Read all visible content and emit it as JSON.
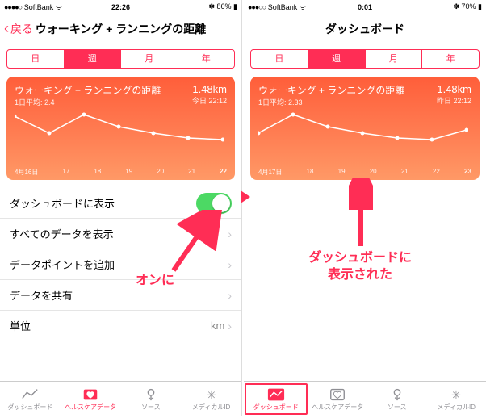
{
  "left": {
    "status": {
      "carrier": "SoftBank",
      "time": "22:26",
      "bt": "86%"
    },
    "back": "戻る",
    "title": "ウォーキング + ランニングの距離",
    "seg": [
      "日",
      "週",
      "月",
      "年"
    ],
    "card": {
      "title": "ウォーキング + ランニングの距離",
      "sub": "1日平均: 2.4",
      "val": "1.48km",
      "time": "今日 22:12",
      "xaxis": [
        "4月16日",
        "17",
        "18",
        "19",
        "20",
        "21",
        "22"
      ]
    },
    "rows": {
      "dash": "ダッシュボードに表示",
      "all": "すべてのデータを表示",
      "pt": "データポイントを追加",
      "share": "データを共有",
      "unit": "単位",
      "unit_val": "km"
    },
    "tabs": [
      "ダッシュボード",
      "ヘルスケアデータ",
      "ソース",
      "メディカルID"
    ],
    "annot": "オンに"
  },
  "right": {
    "status": {
      "carrier": "SoftBank",
      "time": "0:01",
      "bt": "70%"
    },
    "title": "ダッシュボード",
    "seg": [
      "日",
      "週",
      "月",
      "年"
    ],
    "card": {
      "title": "ウォーキング + ランニングの距離",
      "sub": "1日平均: 2.33",
      "val": "1.48km",
      "time": "昨日 22:12",
      "xaxis": [
        "4月17日",
        "18",
        "19",
        "20",
        "21",
        "22",
        "23"
      ]
    },
    "tabs": [
      "ダッシュボード",
      "ヘルスケアデータ",
      "ソース",
      "メディカルID"
    ],
    "annot": "ダッシュボードに\n表示された"
  },
  "chart_data": [
    {
      "type": "line",
      "categories": [
        "4/16",
        "4/17",
        "4/18",
        "4/19",
        "4/20",
        "4/21",
        "4/22"
      ],
      "values": [
        3.4,
        2.0,
        3.5,
        2.5,
        2.0,
        1.6,
        1.48
      ],
      "title": "ウォーキング + ランニングの距離",
      "ylabel": "km",
      "ylim": [
        0,
        4
      ]
    },
    {
      "type": "line",
      "categories": [
        "4/17",
        "4/18",
        "4/19",
        "4/20",
        "4/21",
        "4/22",
        "4/23"
      ],
      "values": [
        2.0,
        3.5,
        2.5,
        2.0,
        1.6,
        1.48,
        2.3
      ],
      "title": "ウォーキング + ランニングの距離",
      "ylabel": "km",
      "ylim": [
        0,
        4
      ]
    }
  ]
}
